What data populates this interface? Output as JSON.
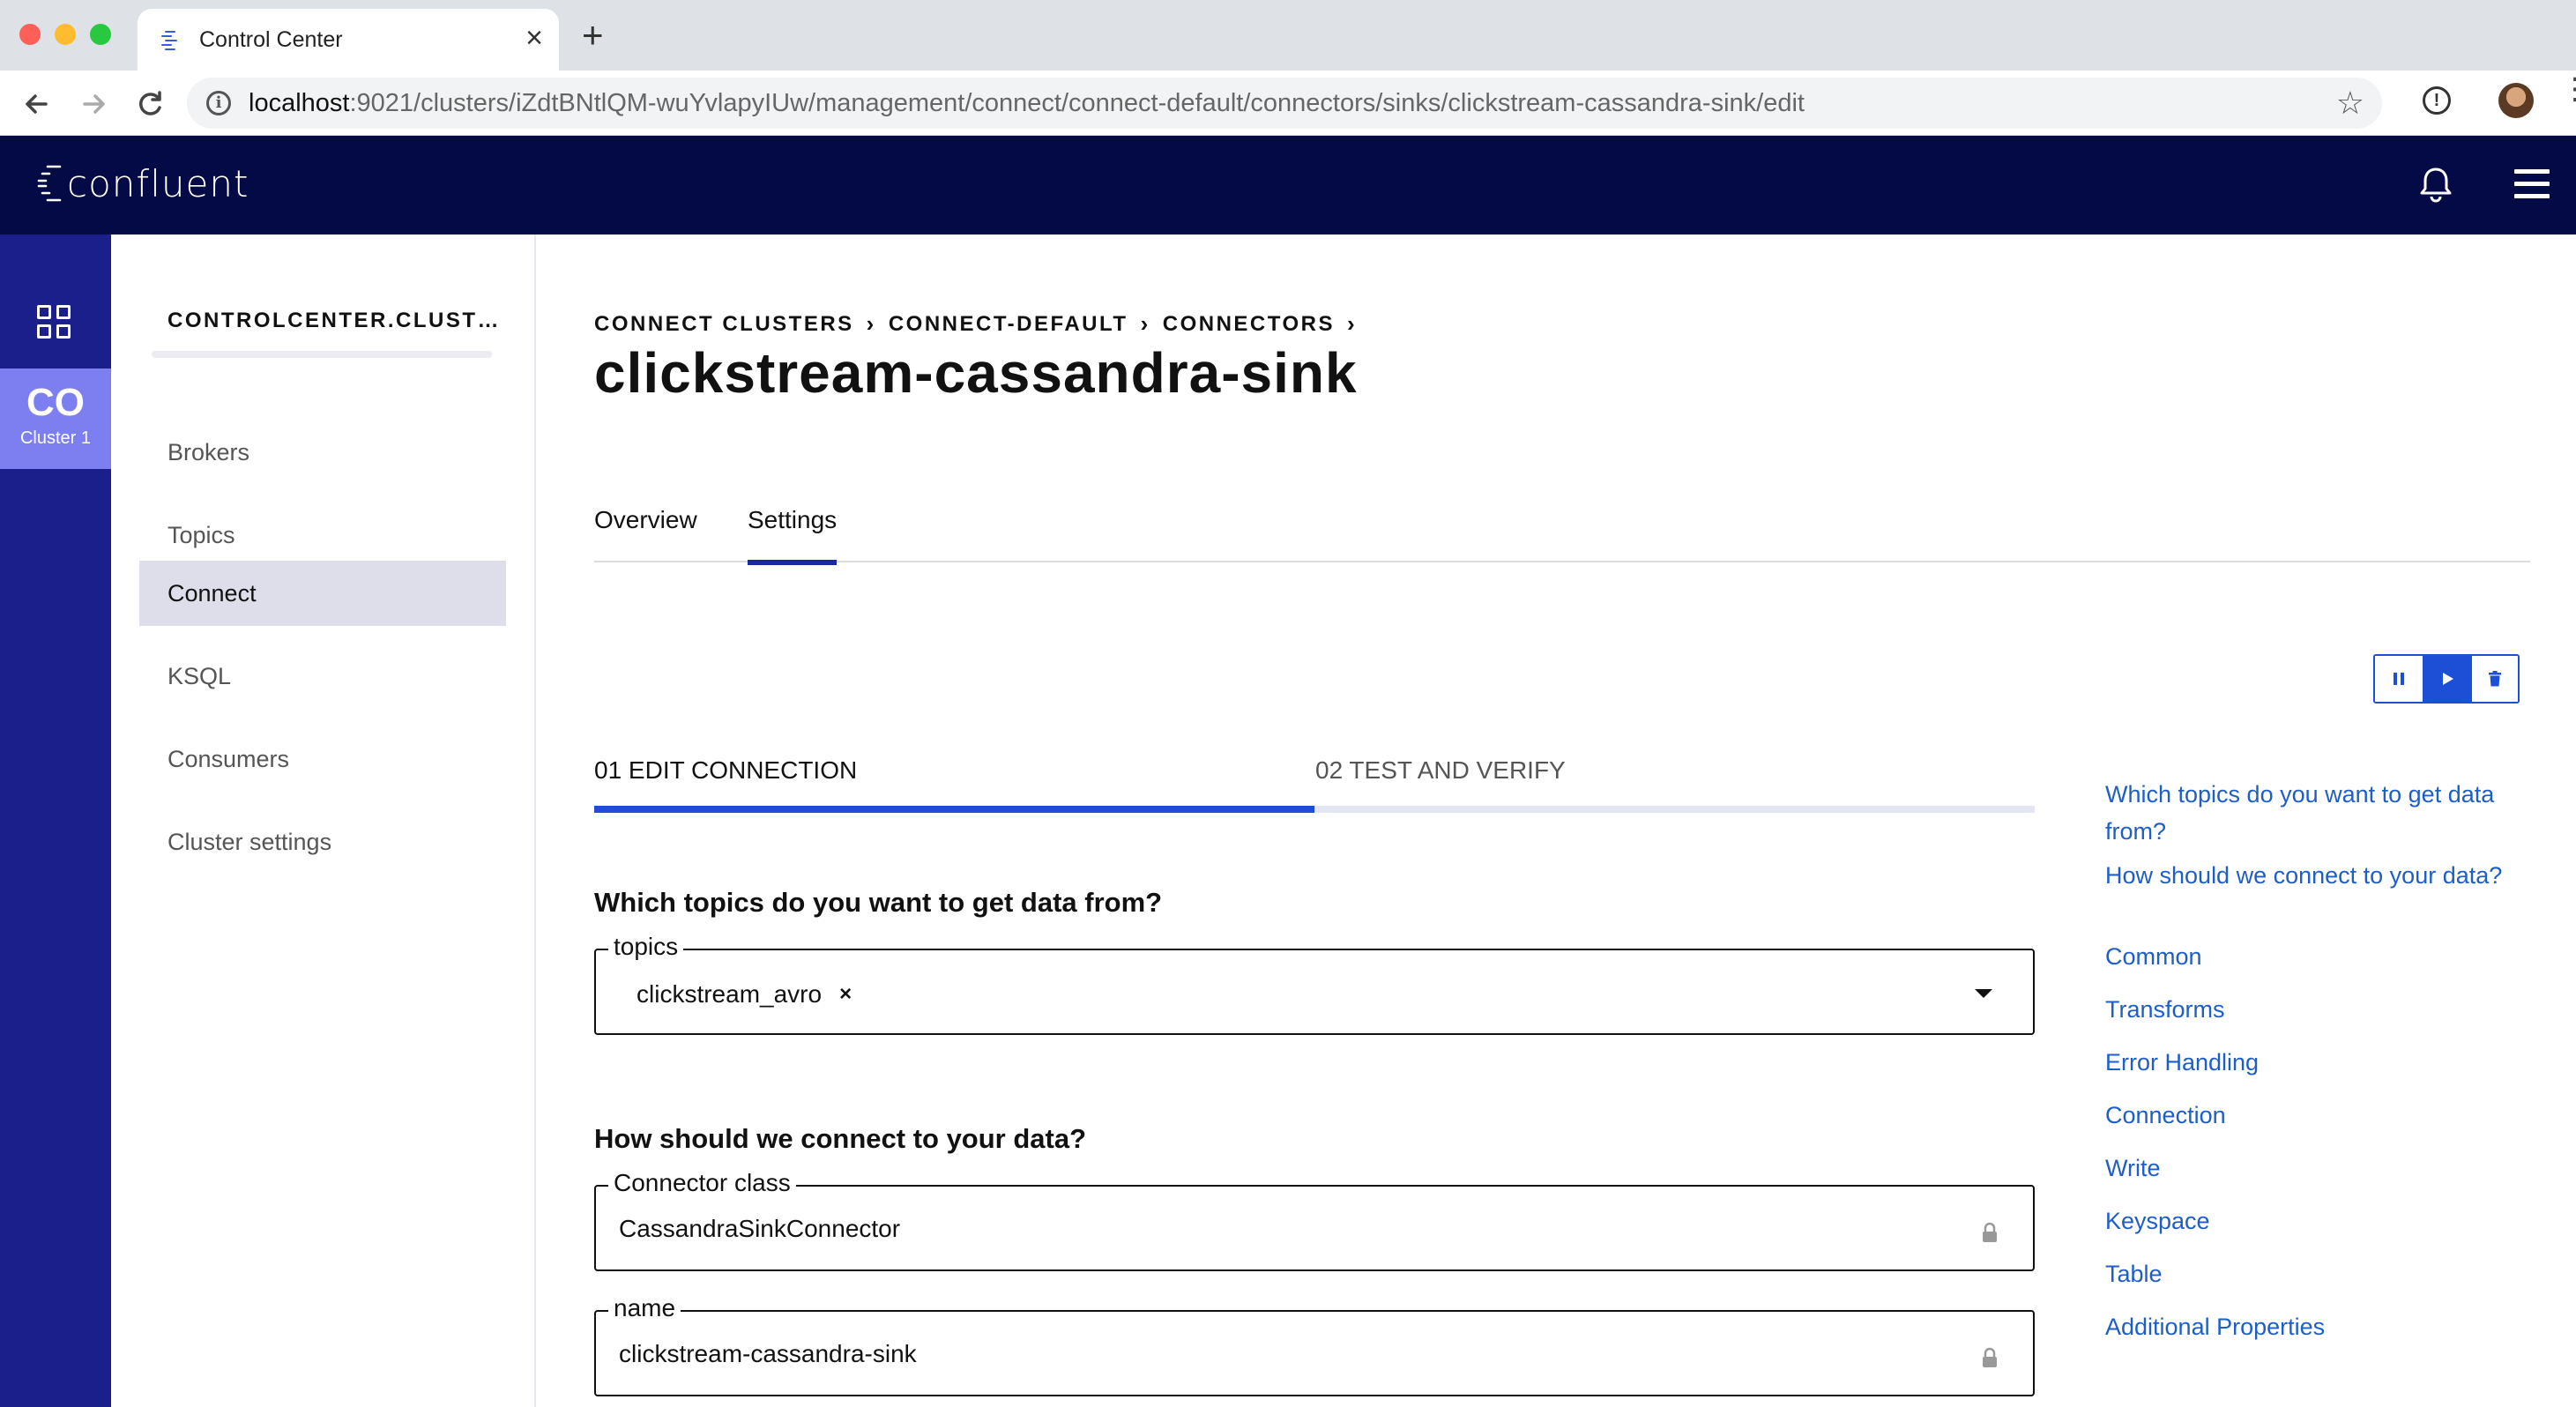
{
  "browser": {
    "tab_title": "Control Center",
    "tab_close": "×",
    "new_tab": "+",
    "url_host": "localhost",
    "url_rest": ":9021/clusters/iZdtBNtlQM-wuYvlapyIUw/management/connect/connect-default/connectors/sinks/clickstream-cassandra-sink/edit",
    "icons": [
      "back-icon",
      "forward-icon",
      "reload-icon",
      "info-icon",
      "star-icon",
      "extension-icon",
      "profile-avatar",
      "kebab-menu-icon"
    ]
  },
  "header": {
    "logo_text": "confluent",
    "icons": [
      "bell-icon",
      "hamburger-menu-icon"
    ],
    "background": "#040a45"
  },
  "rail": {
    "cluster_abbr": "CO",
    "cluster_name": "Cluster 1",
    "background": "#1a1f8c",
    "tile_color": "#7d7ff0"
  },
  "sidebar": {
    "cluster_heading": "CONTROLCENTER.CLUST…",
    "items": [
      {
        "label": "Brokers",
        "active": false
      },
      {
        "label": "Topics",
        "active": false
      },
      {
        "label": "Connect",
        "active": true
      },
      {
        "label": "KSQL",
        "active": false
      },
      {
        "label": "Consumers",
        "active": false
      },
      {
        "label": "Cluster settings",
        "active": false
      }
    ]
  },
  "main": {
    "breadcrumb": [
      "CONNECT CLUSTERS",
      "CONNECT-DEFAULT",
      "CONNECTORS"
    ],
    "breadcrumb_sep": "›",
    "title": "clickstream-cassandra-sink",
    "tabs": [
      {
        "label": "Overview",
        "active": false
      },
      {
        "label": "Settings",
        "active": true
      }
    ],
    "actions": [
      "pause-icon",
      "play-icon",
      "trash-icon"
    ],
    "steps": [
      {
        "label": "01 EDIT CONNECTION",
        "active": true
      },
      {
        "label": "02 TEST AND VERIFY",
        "active": false
      }
    ],
    "progress_fraction": 0.5,
    "sections": {
      "topics_heading": "Which topics do you want to get data from?",
      "connect_heading": "How should we connect to your data?"
    },
    "fields": {
      "topics": {
        "legend": "topics",
        "chips": [
          "clickstream_avro"
        ],
        "chip_remove": "×"
      },
      "connector_class": {
        "legend": "Connector class",
        "value": "CassandraSinkConnector"
      },
      "name": {
        "legend": "name",
        "value": "clickstream-cassandra-sink"
      }
    },
    "toc": [
      "Which topics do you want to get data from?",
      "How should we connect to your data?",
      "Common",
      "Transforms",
      "Error Handling",
      "Connection",
      "Write",
      "Keyspace",
      "Table",
      "Additional Properties"
    ],
    "accent": "#1d4fd6",
    "link_color": "#1d5ec8"
  }
}
